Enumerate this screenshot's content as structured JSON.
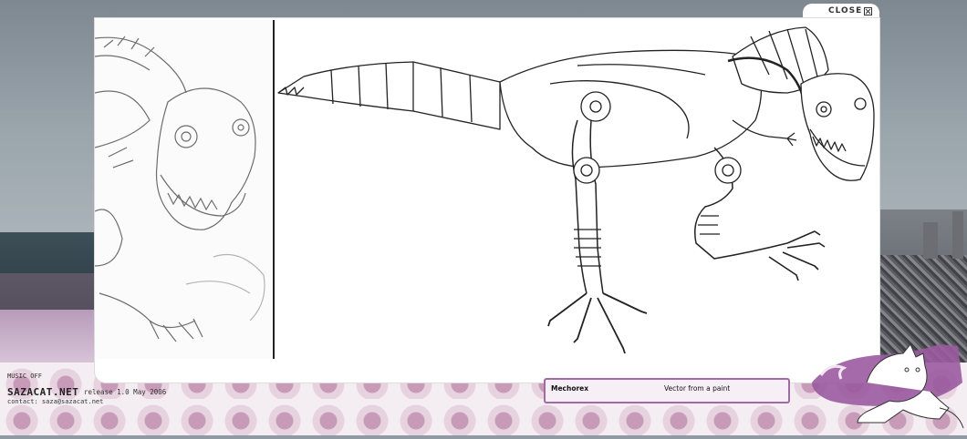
{
  "window": {
    "close_label": "CLOSE"
  },
  "footer": {
    "music_toggle": "MUSIC OFF",
    "site_name": "SAZACAT.NET",
    "release": "release 1.0 May 2006",
    "contact": "contact: saza@sazacat.net"
  },
  "caption": {
    "title": "Mechorex",
    "description": "Vector from a paint"
  },
  "colors": {
    "accent": "#a16aa6",
    "pattern": "#c79ab8",
    "panel": "#ffffff"
  }
}
